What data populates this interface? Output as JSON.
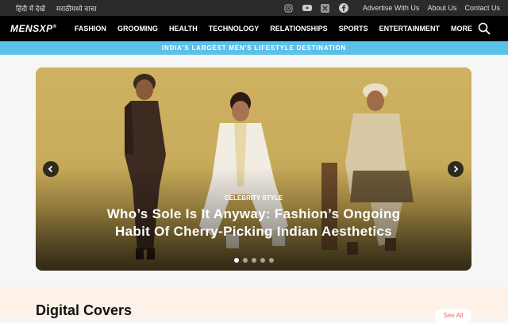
{
  "topbar": {
    "languages": [
      "हिंदी में देखें",
      "मराठीमध्ये वाचा"
    ],
    "social_icons": [
      "instagram-icon",
      "youtube-icon",
      "x-icon",
      "facebook-icon"
    ],
    "links": [
      "Advertise With Us",
      "About Us",
      "Contact Us"
    ]
  },
  "navbar": {
    "logo": "MENSXP",
    "logo_mark": "®",
    "items": [
      "FASHION",
      "GROOMING",
      "HEALTH",
      "TECHNOLOGY",
      "RELATIONSHIPS",
      "SPORTS",
      "ENTERTAINMENT",
      "MORE"
    ]
  },
  "banner": {
    "text": "INDIA'S LARGEST MEN'S LIFESTYLE DESTINATION"
  },
  "hero": {
    "category": "CELEBRITY STYLE",
    "title_line1": "Who’s Sole Is It Anyway: Fashion’s Ongoing",
    "title_line2": "Habit Of Cherry-Picking Indian Aesthetics",
    "slide_count": 5,
    "active_slide": 1
  },
  "covers": {
    "heading": "Digital Covers",
    "see_all": "See All"
  }
}
